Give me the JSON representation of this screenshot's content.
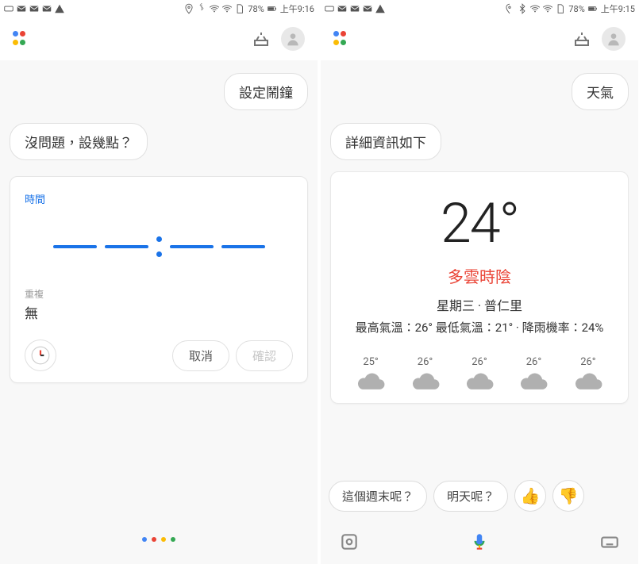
{
  "left": {
    "status": {
      "battery": "78%",
      "time": "上午9:16"
    },
    "user_msg": "設定鬧鐘",
    "asst_msg": "沒問題，設幾點？",
    "card": {
      "time_label": "時間",
      "repeat_label": "重複",
      "repeat_value": "無",
      "cancel": "取消",
      "confirm": "確認"
    }
  },
  "right": {
    "status": {
      "battery": "78%",
      "time": "上午9:15"
    },
    "user_msg": "天氣",
    "asst_msg": "詳細資訊如下",
    "weather": {
      "temp": "24°",
      "condition": "多雲時陰",
      "day_loc": "星期三 · 普仁里",
      "range": "最高氣溫：26° 最低氣溫：21° · 降雨機率：24%",
      "forecast": [
        {
          "t": "25°"
        },
        {
          "t": "26°"
        },
        {
          "t": "26°"
        },
        {
          "t": "26°"
        },
        {
          "t": "26°"
        }
      ]
    },
    "chips": {
      "weekend": "這個週末呢？",
      "tomorrow": "明天呢？",
      "thumbs_up": "👍",
      "thumbs_down": "👎"
    }
  }
}
